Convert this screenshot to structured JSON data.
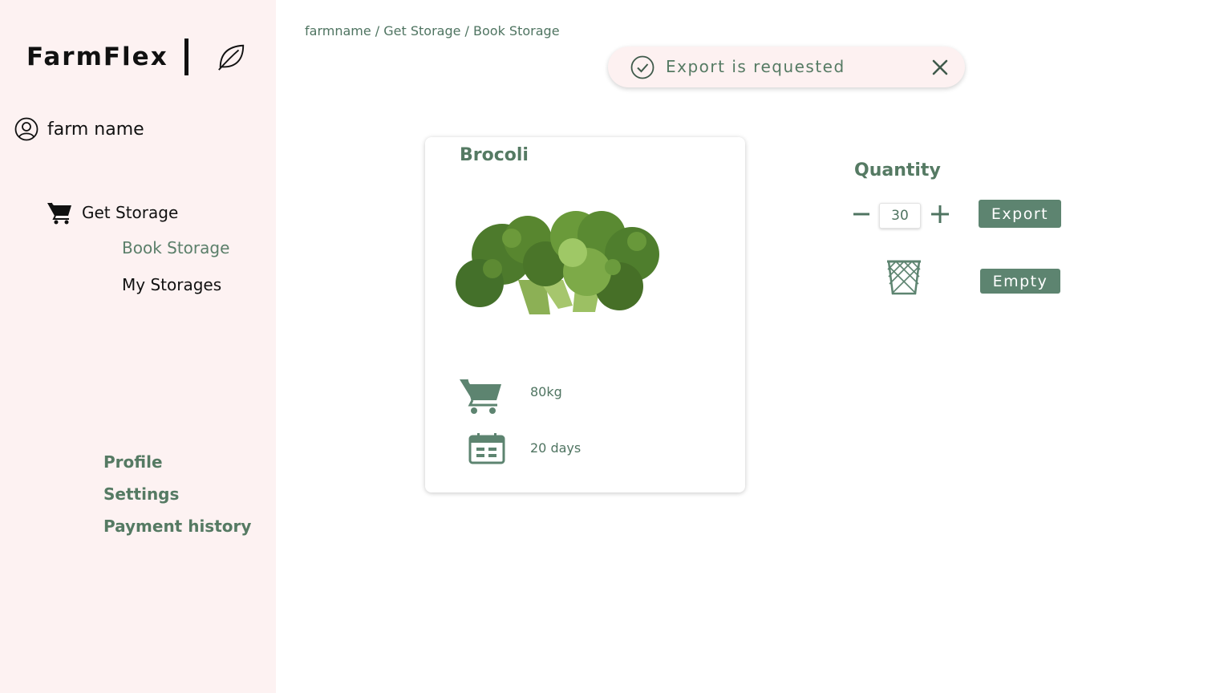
{
  "sidebar": {
    "logo": "FarmFlex",
    "user_name": "farm name",
    "nav_get_storage": "Get Storage",
    "nav_book_storage": "Book Storage",
    "nav_my_storages": "My Storages",
    "nav_profile": "Profile",
    "nav_settings": "Settings",
    "nav_payment_history": "Payment history"
  },
  "breadcrumb": "farmname / Get Storage / Book Storage",
  "toast": {
    "message": "Export is requested"
  },
  "card": {
    "title": "Brocoli",
    "weight": "80kg",
    "duration": "20 days"
  },
  "quantity": {
    "label": "Quantity",
    "value": "30"
  },
  "actions": {
    "export_label": "Export",
    "empty_label": "Empty"
  },
  "colors": {
    "accent": "#5d8470",
    "sidebar_bg": "#fdf2f2",
    "text_green": "#557a63"
  }
}
